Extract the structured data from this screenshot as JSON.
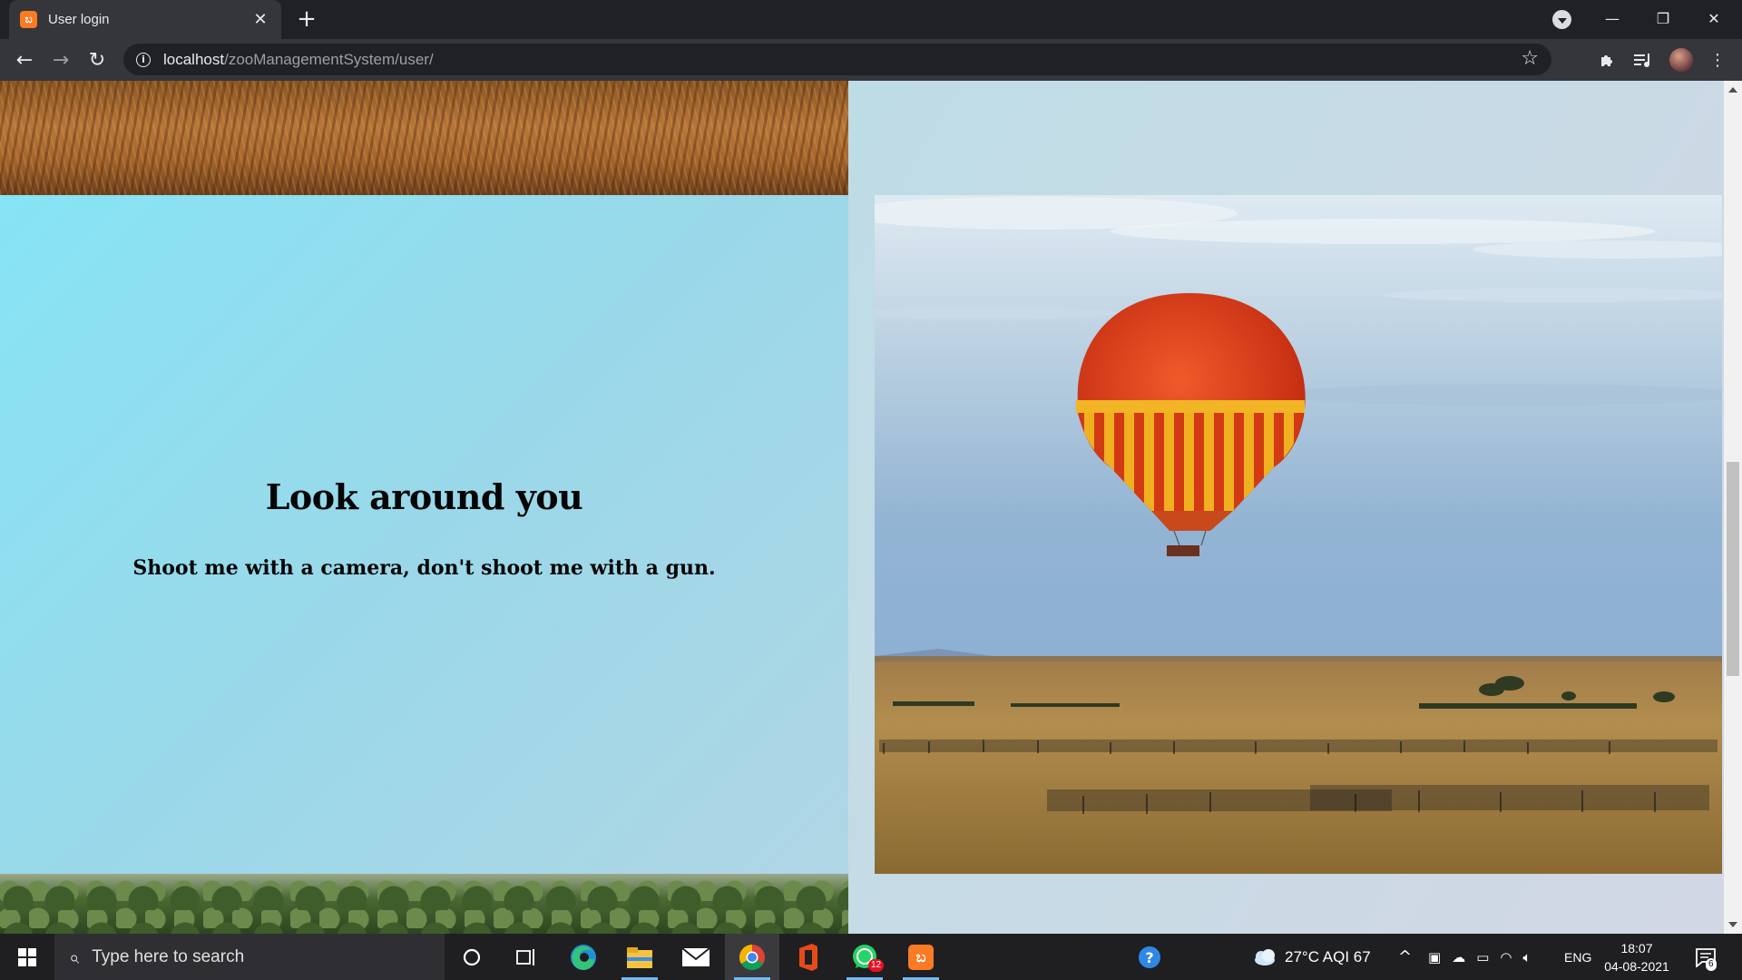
{
  "browser": {
    "tab_title": "User login",
    "favicon_glyph": "ಬ",
    "url_host": "localhost",
    "url_path": "/zooManagementSystem/user/"
  },
  "content": {
    "heading": "Look around you",
    "quote": "Shoot me with a camera, don't shoot me with a gun."
  },
  "taskbar": {
    "search_placeholder": "Type here to search",
    "whatsapp_badge": "12",
    "weather": "27°C  AQI 67",
    "language": "ENG",
    "time": "18:07",
    "date": "04-08-2021",
    "notifications": "6"
  },
  "colors": {
    "panel_gradient_start": "#86e4f5",
    "panel_gradient_end": "#b0d6e5",
    "xampp_orange": "#fb7a24",
    "taskbar_bg": "#1f1f22"
  }
}
